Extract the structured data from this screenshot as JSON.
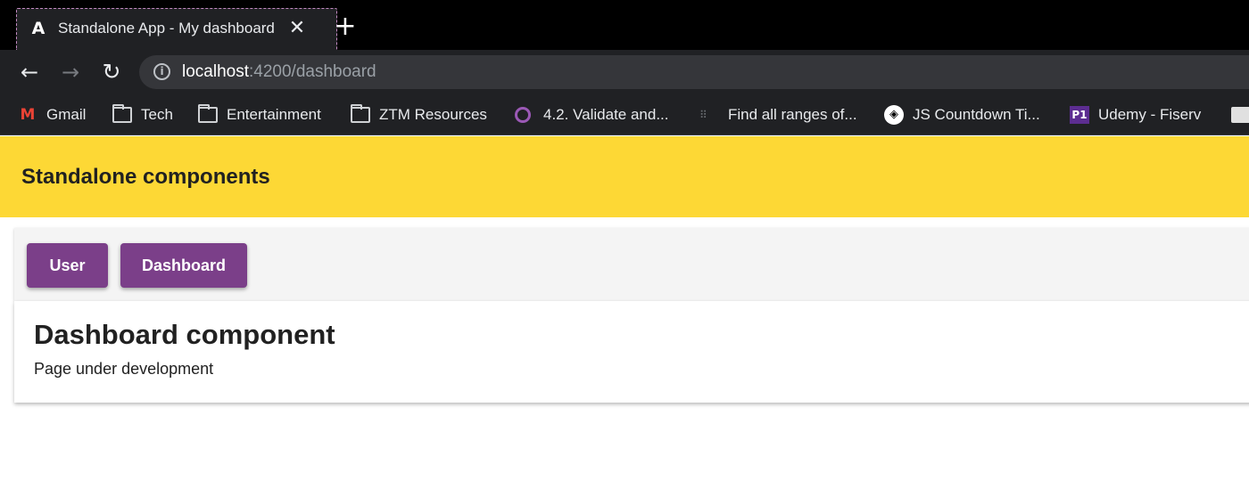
{
  "browser": {
    "tab": {
      "favicon": "A",
      "title": "Standalone App - My dashboard",
      "close": "✕"
    },
    "new_tab": "+",
    "nav": {
      "back": "←",
      "forward": "→",
      "reload": "↻"
    },
    "address": {
      "info_icon": "i",
      "host": "localhost",
      "rest": ":4200/dashboard"
    },
    "bookmarks": [
      {
        "label": "Gmail",
        "icon": "gmail-icon",
        "glyph": "M"
      },
      {
        "label": "Tech",
        "icon": "folder-icon"
      },
      {
        "label": "Entertainment",
        "icon": "folder-icon"
      },
      {
        "label": "ZTM Resources",
        "icon": "folder-icon"
      },
      {
        "label": "4.2. Validate and...",
        "icon": "ring-icon"
      },
      {
        "label": "Find all ranges of...",
        "icon": "dots-icon",
        "glyph": "⠿"
      },
      {
        "label": "JS Countdown Ti...",
        "icon": "codepen-icon",
        "glyph": "◈"
      },
      {
        "label": "Udemy - Fiserv",
        "icon": "p1-icon",
        "glyph": "P1"
      }
    ]
  },
  "app": {
    "header_title": "Standalone components",
    "buttons": {
      "user": "User",
      "dashboard": "Dashboard"
    },
    "card": {
      "title": "Dashboard component",
      "text": "Page under development"
    }
  },
  "colors": {
    "header": "#fdd835",
    "button": "#7b3f89",
    "chrome_dark": "#202124"
  }
}
